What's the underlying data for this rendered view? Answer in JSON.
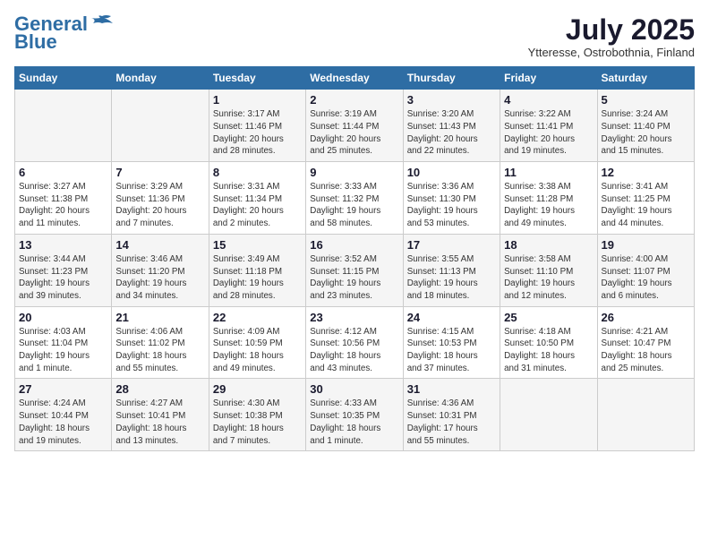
{
  "logo": {
    "line1": "General",
    "line2": "Blue"
  },
  "title": "July 2025",
  "subtitle": "Ytteresse, Ostrobothnia, Finland",
  "weekdays": [
    "Sunday",
    "Monday",
    "Tuesday",
    "Wednesday",
    "Thursday",
    "Friday",
    "Saturday"
  ],
  "weeks": [
    [
      {
        "day": "",
        "detail": ""
      },
      {
        "day": "",
        "detail": ""
      },
      {
        "day": "1",
        "detail": "Sunrise: 3:17 AM\nSunset: 11:46 PM\nDaylight: 20 hours\nand 28 minutes."
      },
      {
        "day": "2",
        "detail": "Sunrise: 3:19 AM\nSunset: 11:44 PM\nDaylight: 20 hours\nand 25 minutes."
      },
      {
        "day": "3",
        "detail": "Sunrise: 3:20 AM\nSunset: 11:43 PM\nDaylight: 20 hours\nand 22 minutes."
      },
      {
        "day": "4",
        "detail": "Sunrise: 3:22 AM\nSunset: 11:41 PM\nDaylight: 20 hours\nand 19 minutes."
      },
      {
        "day": "5",
        "detail": "Sunrise: 3:24 AM\nSunset: 11:40 PM\nDaylight: 20 hours\nand 15 minutes."
      }
    ],
    [
      {
        "day": "6",
        "detail": "Sunrise: 3:27 AM\nSunset: 11:38 PM\nDaylight: 20 hours\nand 11 minutes."
      },
      {
        "day": "7",
        "detail": "Sunrise: 3:29 AM\nSunset: 11:36 PM\nDaylight: 20 hours\nand 7 minutes."
      },
      {
        "day": "8",
        "detail": "Sunrise: 3:31 AM\nSunset: 11:34 PM\nDaylight: 20 hours\nand 2 minutes."
      },
      {
        "day": "9",
        "detail": "Sunrise: 3:33 AM\nSunset: 11:32 PM\nDaylight: 19 hours\nand 58 minutes."
      },
      {
        "day": "10",
        "detail": "Sunrise: 3:36 AM\nSunset: 11:30 PM\nDaylight: 19 hours\nand 53 minutes."
      },
      {
        "day": "11",
        "detail": "Sunrise: 3:38 AM\nSunset: 11:28 PM\nDaylight: 19 hours\nand 49 minutes."
      },
      {
        "day": "12",
        "detail": "Sunrise: 3:41 AM\nSunset: 11:25 PM\nDaylight: 19 hours\nand 44 minutes."
      }
    ],
    [
      {
        "day": "13",
        "detail": "Sunrise: 3:44 AM\nSunset: 11:23 PM\nDaylight: 19 hours\nand 39 minutes."
      },
      {
        "day": "14",
        "detail": "Sunrise: 3:46 AM\nSunset: 11:20 PM\nDaylight: 19 hours\nand 34 minutes."
      },
      {
        "day": "15",
        "detail": "Sunrise: 3:49 AM\nSunset: 11:18 PM\nDaylight: 19 hours\nand 28 minutes."
      },
      {
        "day": "16",
        "detail": "Sunrise: 3:52 AM\nSunset: 11:15 PM\nDaylight: 19 hours\nand 23 minutes."
      },
      {
        "day": "17",
        "detail": "Sunrise: 3:55 AM\nSunset: 11:13 PM\nDaylight: 19 hours\nand 18 minutes."
      },
      {
        "day": "18",
        "detail": "Sunrise: 3:58 AM\nSunset: 11:10 PM\nDaylight: 19 hours\nand 12 minutes."
      },
      {
        "day": "19",
        "detail": "Sunrise: 4:00 AM\nSunset: 11:07 PM\nDaylight: 19 hours\nand 6 minutes."
      }
    ],
    [
      {
        "day": "20",
        "detail": "Sunrise: 4:03 AM\nSunset: 11:04 PM\nDaylight: 19 hours\nand 1 minute."
      },
      {
        "day": "21",
        "detail": "Sunrise: 4:06 AM\nSunset: 11:02 PM\nDaylight: 18 hours\nand 55 minutes."
      },
      {
        "day": "22",
        "detail": "Sunrise: 4:09 AM\nSunset: 10:59 PM\nDaylight: 18 hours\nand 49 minutes."
      },
      {
        "day": "23",
        "detail": "Sunrise: 4:12 AM\nSunset: 10:56 PM\nDaylight: 18 hours\nand 43 minutes."
      },
      {
        "day": "24",
        "detail": "Sunrise: 4:15 AM\nSunset: 10:53 PM\nDaylight: 18 hours\nand 37 minutes."
      },
      {
        "day": "25",
        "detail": "Sunrise: 4:18 AM\nSunset: 10:50 PM\nDaylight: 18 hours\nand 31 minutes."
      },
      {
        "day": "26",
        "detail": "Sunrise: 4:21 AM\nSunset: 10:47 PM\nDaylight: 18 hours\nand 25 minutes."
      }
    ],
    [
      {
        "day": "27",
        "detail": "Sunrise: 4:24 AM\nSunset: 10:44 PM\nDaylight: 18 hours\nand 19 minutes."
      },
      {
        "day": "28",
        "detail": "Sunrise: 4:27 AM\nSunset: 10:41 PM\nDaylight: 18 hours\nand 13 minutes."
      },
      {
        "day": "29",
        "detail": "Sunrise: 4:30 AM\nSunset: 10:38 PM\nDaylight: 18 hours\nand 7 minutes."
      },
      {
        "day": "30",
        "detail": "Sunrise: 4:33 AM\nSunset: 10:35 PM\nDaylight: 18 hours\nand 1 minute."
      },
      {
        "day": "31",
        "detail": "Sunrise: 4:36 AM\nSunset: 10:31 PM\nDaylight: 17 hours\nand 55 minutes."
      },
      {
        "day": "",
        "detail": ""
      },
      {
        "day": "",
        "detail": ""
      }
    ]
  ]
}
